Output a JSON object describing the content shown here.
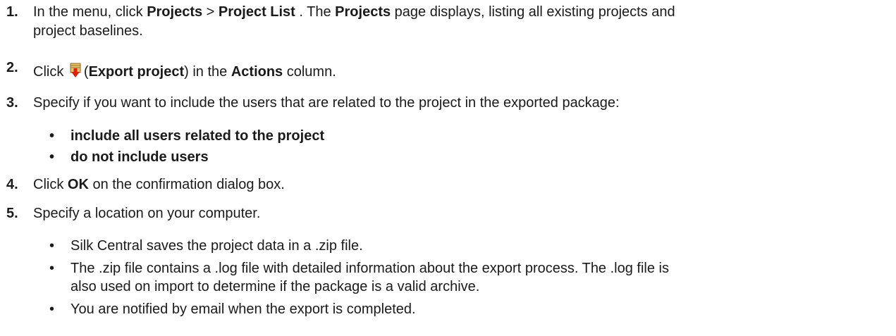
{
  "steps": [
    {
      "number": "1.",
      "parts": [
        "In the menu, click ",
        "Projects",
        " > ",
        "Project List",
        " . The ",
        "Projects",
        " page displays, listing all existing projects and",
        "project baselines."
      ]
    },
    {
      "number": "2.",
      "parts": [
        "Click ",
        "(",
        "Export project",
        ") in the ",
        "Actions",
        " column."
      ],
      "icon": "export-project-icon"
    },
    {
      "number": "3.",
      "text": "Specify if you want to include the users that are related to the project in the exported package:",
      "options": [
        "include all users related to the project",
        "do not include users"
      ]
    },
    {
      "number": "4.",
      "parts": [
        "Click ",
        "OK",
        " on the confirmation dialog box."
      ]
    },
    {
      "number": "5.",
      "text": "Specify a location on your computer.",
      "notes": [
        "Silk Central saves the project data in a .zip file.",
        "The .zip file contains a .log file with detailed information about the export process. The .log file is",
        "also used on import to determine if the package is a valid archive.",
        "You are notified by email when the export is completed."
      ]
    }
  ],
  "bullet_char": "•",
  "colors": {
    "text": "#1a1a1a",
    "icon_red": "#d9230f",
    "icon_body": "#e8c26a"
  }
}
